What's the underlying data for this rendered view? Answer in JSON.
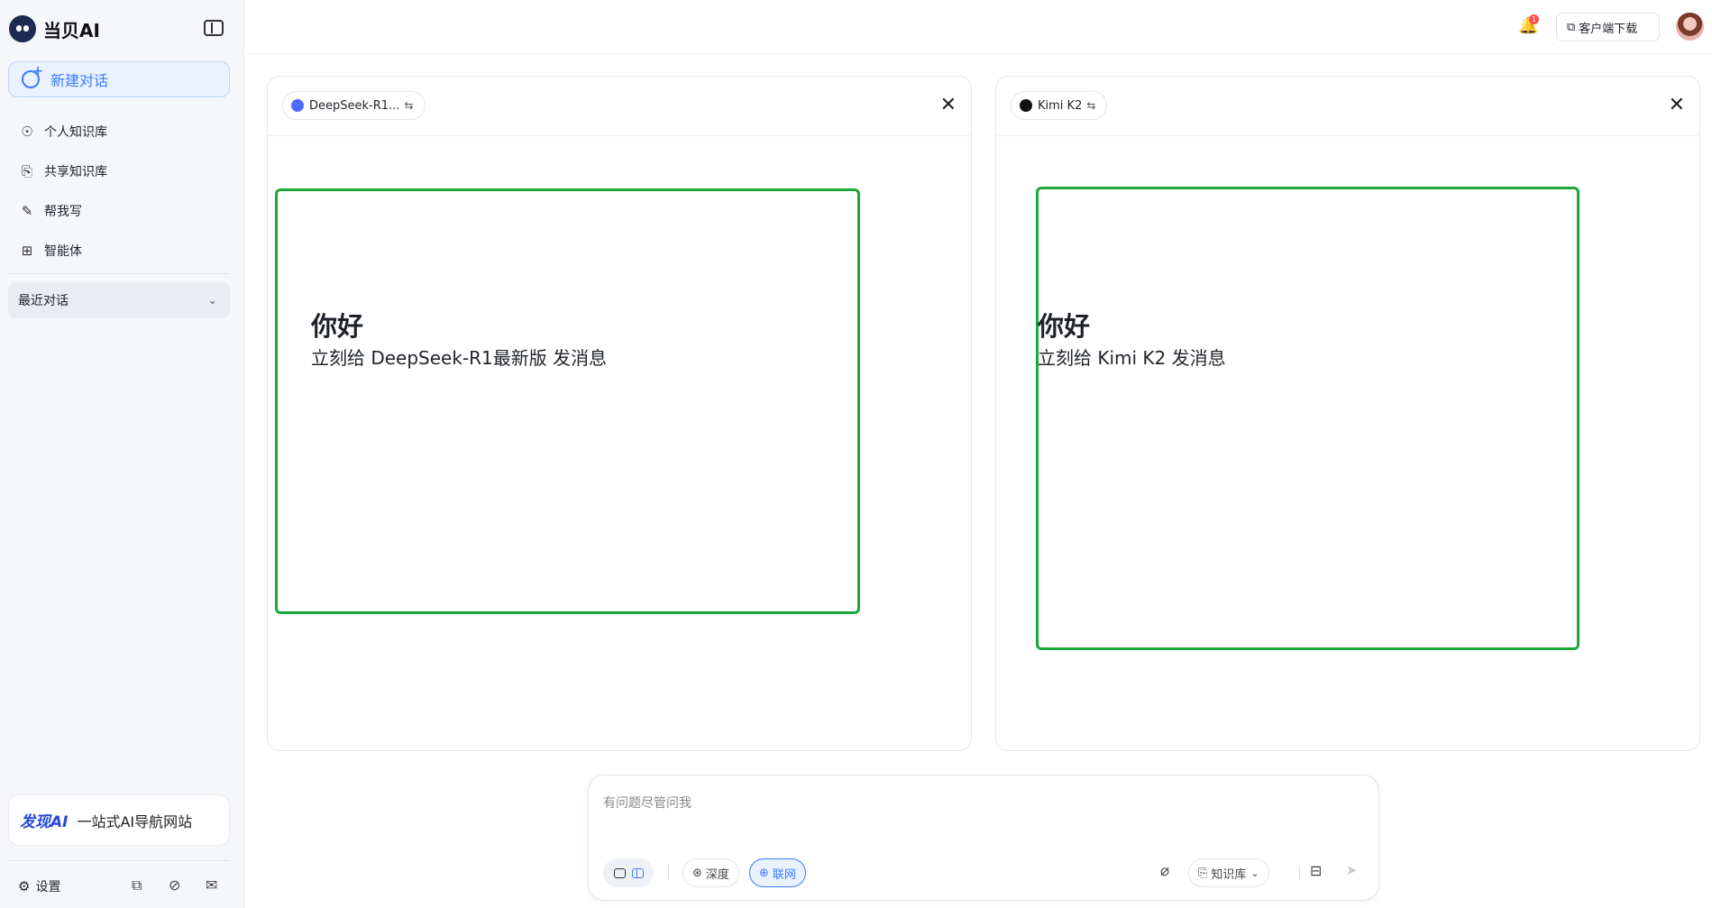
{
  "app": {
    "brand": "当贝AI"
  },
  "sidebar": {
    "new_chat": "新建对话",
    "items": [
      {
        "label": "个人知识库",
        "icon": "bulb-icon"
      },
      {
        "label": "共享知识库",
        "icon": "shared-folder-icon"
      },
      {
        "label": "帮我写",
        "icon": "pen-icon"
      },
      {
        "label": "智能体",
        "icon": "apps-icon"
      }
    ],
    "recent": "最近对话",
    "promo": {
      "logo": "发现AI",
      "text": "一站式AI导航网站"
    },
    "settings": "设置"
  },
  "header": {
    "notification_count": "1",
    "download": "客户端下载"
  },
  "panels": [
    {
      "model": "DeepSeek-R1...",
      "greeting": "你好",
      "subtitle": "立刻给 DeepSeek-R1最新版 发消息"
    },
    {
      "model": "Kimi K2",
      "greeting": "你好",
      "subtitle": "立刻给 Kimi K2 发消息"
    }
  ],
  "composer": {
    "placeholder": "有问题尽管问我",
    "deep": "深度",
    "web": "联网",
    "knowledge": "知识库"
  },
  "colors": {
    "accent": "#3b7cff",
    "highlight_box": "#1aa83a"
  }
}
